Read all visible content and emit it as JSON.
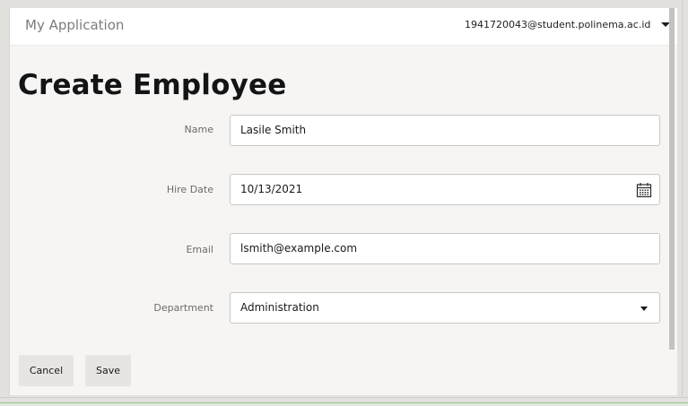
{
  "header": {
    "app_title": "My Application",
    "user_email": "1941720043@student.polinema.ac.id",
    "user_menu_icon": "chevron-down-icon"
  },
  "page": {
    "title": "Create Employee"
  },
  "form": {
    "name": {
      "label": "Name",
      "value": "Lasile Smith"
    },
    "hire_date": {
      "label": "Hire Date",
      "value": "10/13/2021",
      "icon": "calendar-icon"
    },
    "email": {
      "label": "Email",
      "value": "lsmith@example.com"
    },
    "department": {
      "label": "Department",
      "value": "Administration",
      "icon": "chevron-down-icon"
    }
  },
  "actions": {
    "cancel_label": "Cancel",
    "save_label": "Save"
  }
}
